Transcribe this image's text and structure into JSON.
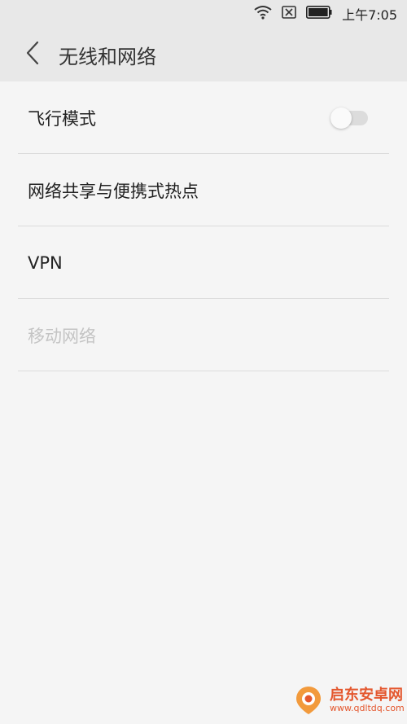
{
  "status_bar": {
    "time": "上午7:05",
    "icons": [
      "wifi-icon",
      "no-sim-icon",
      "battery-icon"
    ]
  },
  "header": {
    "title": "无线和网络",
    "back_icon": "chevron-left-icon"
  },
  "settings": {
    "items": [
      {
        "label": "飞行模式",
        "toggle": true,
        "toggle_on": false,
        "enabled": true
      },
      {
        "label": "网络共享与便携式热点",
        "toggle": false,
        "enabled": true
      },
      {
        "label": "VPN",
        "toggle": false,
        "enabled": true
      },
      {
        "label": "移动网络",
        "toggle": false,
        "enabled": false
      }
    ]
  },
  "watermark": {
    "name": "启东安卓网",
    "url": "www.qdltdq.com"
  },
  "colors": {
    "background": "#f5f5f5",
    "header": "#e8e8e8",
    "text": "#222222",
    "disabled_text": "#c4c4c4",
    "divider": "#dcdcdc",
    "watermark": "#e4572e"
  }
}
